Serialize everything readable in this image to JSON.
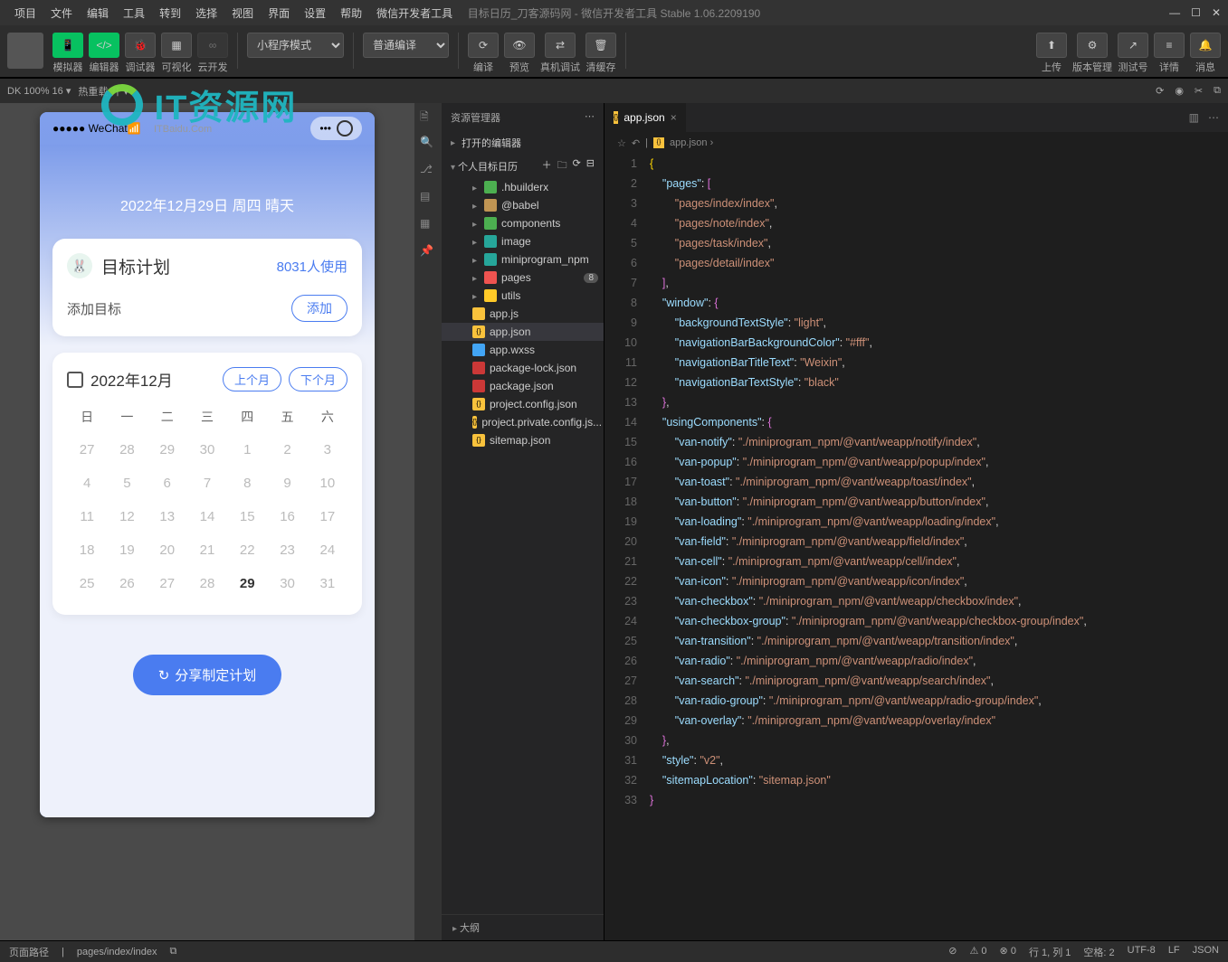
{
  "menubar": {
    "items": [
      "项目",
      "文件",
      "编辑",
      "工具",
      "转到",
      "选择",
      "视图",
      "界面",
      "设置",
      "帮助",
      "微信开发者工具"
    ],
    "title": "目标日历_刀客源码网 - 微信开发者工具 Stable 1.06.2209190"
  },
  "toolbar": {
    "groups": [
      {
        "icon": "📱",
        "label": "模拟器",
        "green": true
      },
      {
        "icon": "</>",
        "label": "编辑器",
        "green": true
      },
      {
        "icon": "🐞",
        "label": "调试器"
      },
      {
        "icon": "▦",
        "label": "可视化"
      },
      {
        "icon": "∞",
        "label": "云开发",
        "dim": true
      }
    ],
    "mode_select": "小程序模式",
    "compile_select": "普通编译",
    "actions": [
      {
        "icon": "⟳",
        "label": "编译"
      },
      {
        "icon": "👁",
        "label": "预览"
      },
      {
        "icon": "⇄",
        "label": "真机调试"
      },
      {
        "icon": "🗑",
        "label": "清缓存"
      }
    ],
    "right": [
      {
        "icon": "⬆",
        "label": "上传"
      },
      {
        "icon": "⚙",
        "label": "版本管理"
      },
      {
        "icon": "↗",
        "label": "测试号"
      },
      {
        "icon": "≡",
        "label": "详情"
      },
      {
        "icon": "🔔",
        "label": "消息"
      }
    ]
  },
  "devbar": {
    "left": "DK 100% 16 ▾",
    "hot": "热重载 开 ▾"
  },
  "simulator": {
    "status_left": "●●●●● WeChat",
    "wifi": "📶",
    "capsule_dots": "•••",
    "date_header": "2022年12月29日 周四 晴天",
    "goal": {
      "title": "目标计划",
      "count": "8031人使用",
      "add_label": "添加目标",
      "add_btn": "添加"
    },
    "calendar": {
      "month": "2022年12月",
      "prev": "上个月",
      "next": "下个月",
      "weekdays": [
        "日",
        "一",
        "二",
        "三",
        "四",
        "五",
        "六"
      ],
      "rows": [
        [
          "27",
          "28",
          "29",
          "30",
          "1",
          "2",
          "3"
        ],
        [
          "4",
          "5",
          "6",
          "7",
          "8",
          "9",
          "10"
        ],
        [
          "11",
          "12",
          "13",
          "14",
          "15",
          "16",
          "17"
        ],
        [
          "18",
          "19",
          "20",
          "21",
          "22",
          "23",
          "24"
        ],
        [
          "25",
          "26",
          "27",
          "28",
          "29",
          "30",
          "31"
        ]
      ],
      "current": "29"
    },
    "share_btn": "分享制定计划"
  },
  "explorer": {
    "header": "资源管理器",
    "open_editors": "打开的编辑器",
    "project": "个人目标日历",
    "tree": [
      {
        "name": ".hbuilderx",
        "type": "folder",
        "cls": "hb"
      },
      {
        "name": "@babel",
        "type": "folder",
        "cls": "folder"
      },
      {
        "name": "components",
        "type": "folder",
        "cls": "cmp"
      },
      {
        "name": "image",
        "type": "folder",
        "cls": "img"
      },
      {
        "name": "miniprogram_npm",
        "type": "folder",
        "cls": "npm"
      },
      {
        "name": "pages",
        "type": "folder",
        "cls": "pg",
        "badge": "8"
      },
      {
        "name": "utils",
        "type": "folder",
        "cls": "ut"
      },
      {
        "name": "app.js",
        "type": "file",
        "cls": "js"
      },
      {
        "name": "app.json",
        "type": "file",
        "cls": "json",
        "selected": true
      },
      {
        "name": "app.wxss",
        "type": "file",
        "cls": "css"
      },
      {
        "name": "package-lock.json",
        "type": "file",
        "cls": "lock"
      },
      {
        "name": "package.json",
        "type": "file",
        "cls": "lock"
      },
      {
        "name": "project.config.json",
        "type": "file",
        "cls": "json"
      },
      {
        "name": "project.private.config.js...",
        "type": "file",
        "cls": "json"
      },
      {
        "name": "sitemap.json",
        "type": "file",
        "cls": "json"
      }
    ],
    "outline": "大纲"
  },
  "editor": {
    "tab_label": "app.json",
    "crumb": "app.json ›",
    "lines": [
      {
        "n": 1,
        "t": "{",
        "indent": 0,
        "br": 1
      },
      {
        "n": 2,
        "t": "\"pages\": [",
        "indent": 1,
        "key": "pages",
        "open": "[",
        "br": 2
      },
      {
        "n": 3,
        "t": "\"pages/index/index\",",
        "indent": 2,
        "str": "pages/index/index",
        "comma": true
      },
      {
        "n": 4,
        "t": "\"pages/note/index\",",
        "indent": 2,
        "str": "pages/note/index",
        "comma": true
      },
      {
        "n": 5,
        "t": "\"pages/task/index\",",
        "indent": 2,
        "str": "pages/task/index",
        "comma": true
      },
      {
        "n": 6,
        "t": "\"pages/detail/index\"",
        "indent": 2,
        "str": "pages/detail/index"
      },
      {
        "n": 7,
        "t": "],",
        "indent": 1,
        "close": "]",
        "comma": true,
        "br": 2
      },
      {
        "n": 8,
        "t": "\"window\": {",
        "indent": 1,
        "key": "window",
        "open": "{",
        "br": 2
      },
      {
        "n": 9,
        "t": "\"backgroundTextStyle\": \"light\",",
        "indent": 2,
        "key": "backgroundTextStyle",
        "val": "light",
        "comma": true
      },
      {
        "n": 10,
        "t": "\"navigationBarBackgroundColor\": \"#fff\",",
        "indent": 2,
        "key": "navigationBarBackgroundColor",
        "val": "#fff",
        "comma": true
      },
      {
        "n": 11,
        "t": "\"navigationBarTitleText\": \"Weixin\",",
        "indent": 2,
        "key": "navigationBarTitleText",
        "val": "Weixin",
        "comma": true
      },
      {
        "n": 12,
        "t": "\"navigationBarTextStyle\": \"black\"",
        "indent": 2,
        "key": "navigationBarTextStyle",
        "val": "black"
      },
      {
        "n": 13,
        "t": "},",
        "indent": 1,
        "close": "}",
        "comma": true,
        "br": 2
      },
      {
        "n": 14,
        "t": "\"usingComponents\": {",
        "indent": 1,
        "key": "usingComponents",
        "open": "{",
        "br": 2
      },
      {
        "n": 15,
        "t": "",
        "indent": 2,
        "key": "van-notify",
        "val": "./miniprogram_npm/@vant/weapp/notify/index",
        "comma": true
      },
      {
        "n": 16,
        "t": "",
        "indent": 2,
        "key": "van-popup",
        "val": "./miniprogram_npm/@vant/weapp/popup/index",
        "comma": true
      },
      {
        "n": 17,
        "t": "",
        "indent": 2,
        "key": "van-toast",
        "val": "./miniprogram_npm/@vant/weapp/toast/index",
        "comma": true
      },
      {
        "n": 18,
        "t": "",
        "indent": 2,
        "key": "van-button",
        "val": "./miniprogram_npm/@vant/weapp/button/index",
        "comma": true
      },
      {
        "n": 19,
        "t": "",
        "indent": 2,
        "key": "van-loading",
        "val": "./miniprogram_npm/@vant/weapp/loading/index",
        "comma": true
      },
      {
        "n": 20,
        "t": "",
        "indent": 2,
        "key": "van-field",
        "val": "./miniprogram_npm/@vant/weapp/field/index",
        "comma": true
      },
      {
        "n": 21,
        "t": "",
        "indent": 2,
        "key": "van-cell",
        "val": "./miniprogram_npm/@vant/weapp/cell/index",
        "comma": true
      },
      {
        "n": 22,
        "t": "",
        "indent": 2,
        "key": "van-icon",
        "val": "./miniprogram_npm/@vant/weapp/icon/index",
        "comma": true
      },
      {
        "n": 23,
        "t": "",
        "indent": 2,
        "key": "van-checkbox",
        "val": "./miniprogram_npm/@vant/weapp/checkbox/index",
        "comma": true
      },
      {
        "n": 24,
        "t": "",
        "indent": 2,
        "key": "van-checkbox-group",
        "val": "./miniprogram_npm/@vant/weapp/checkbox-group/index",
        "comma": true
      },
      {
        "n": 25,
        "t": "",
        "indent": 2,
        "key": "van-transition",
        "val": "./miniprogram_npm/@vant/weapp/transition/index",
        "comma": true
      },
      {
        "n": 26,
        "t": "",
        "indent": 2,
        "key": "van-radio",
        "val": "./miniprogram_npm/@vant/weapp/radio/index",
        "comma": true
      },
      {
        "n": 27,
        "t": "",
        "indent": 2,
        "key": "van-search",
        "val": "./miniprogram_npm/@vant/weapp/search/index",
        "comma": true
      },
      {
        "n": 28,
        "t": "",
        "indent": 2,
        "key": "van-radio-group",
        "val": "./miniprogram_npm/@vant/weapp/radio-group/index",
        "comma": true
      },
      {
        "n": 29,
        "t": "",
        "indent": 2,
        "key": "van-overlay",
        "val": "./miniprogram_npm/@vant/weapp/overlay/index"
      },
      {
        "n": 30,
        "t": "},",
        "indent": 1,
        "close": "}",
        "comma": true,
        "br": 2
      },
      {
        "n": 31,
        "t": "",
        "indent": 1,
        "key": "style",
        "val": "v2",
        "comma": true
      },
      {
        "n": 32,
        "t": "",
        "indent": 1,
        "key": "sitemapLocation",
        "val": "sitemap.json"
      },
      {
        "n": 33,
        "t": "}",
        "indent": 0,
        "close": "}",
        "br": 1
      }
    ]
  },
  "statusbar": {
    "path_label": "页面路径",
    "path": "pages/index/index",
    "scene": "⊘",
    "warn": "⚠ 0",
    "err": "⊗ 0",
    "pos": "行 1, 列 1",
    "spaces": "空格: 2",
    "enc": "UTF-8",
    "eol": "LF",
    "lang": "JSON"
  },
  "watermark": {
    "text": "IT资源网",
    "sub": "ITBaidu.Com"
  }
}
